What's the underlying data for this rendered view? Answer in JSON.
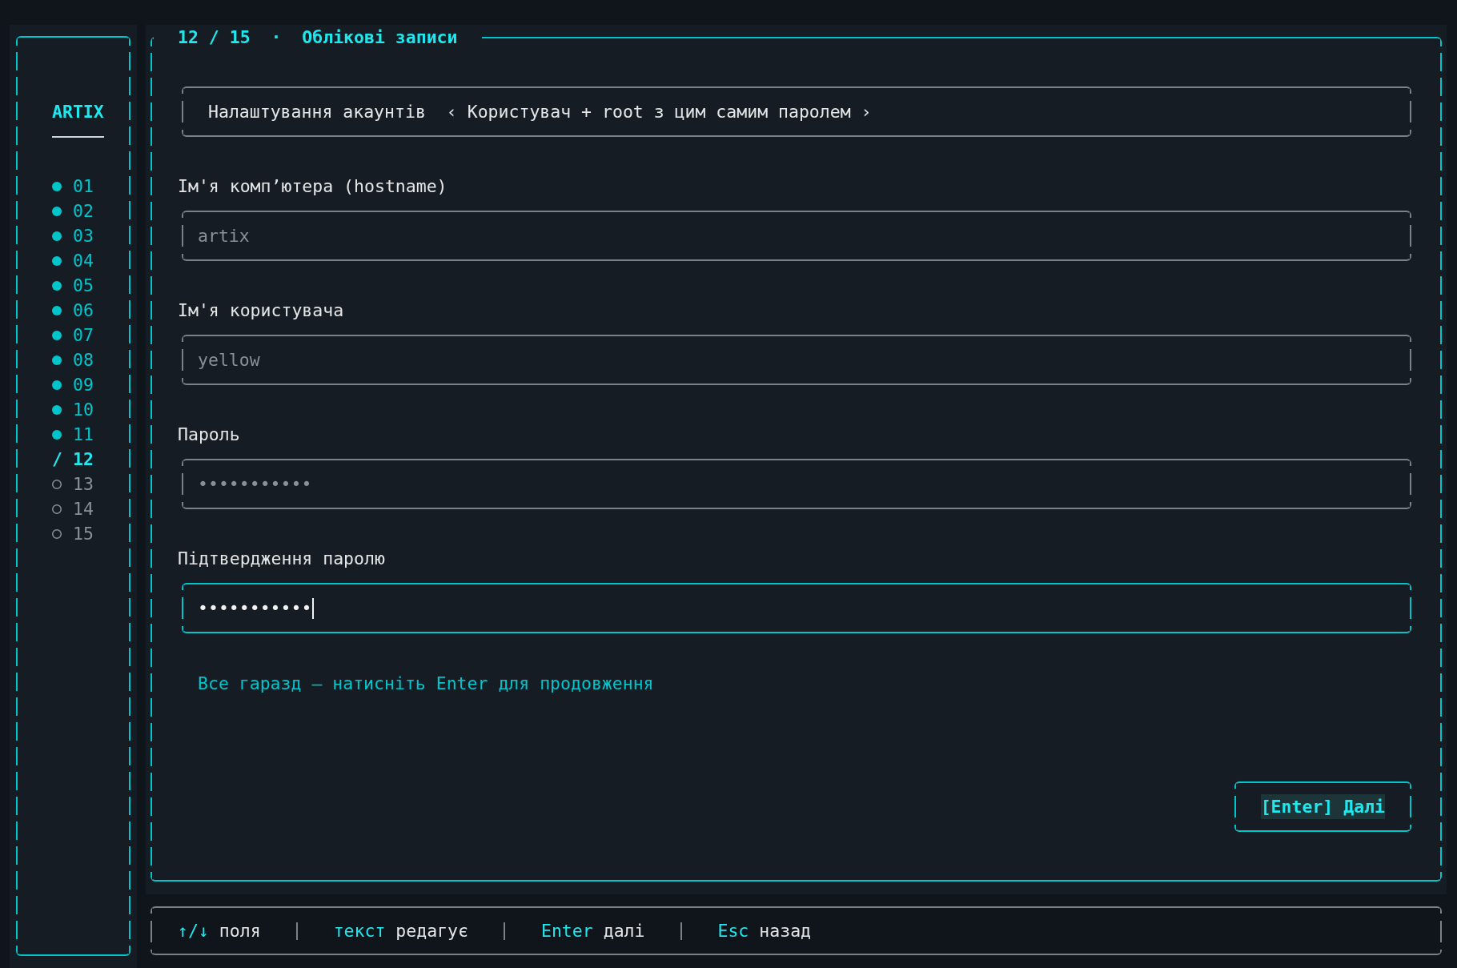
{
  "sidebar": {
    "brand": "ARTIX",
    "steps": [
      {
        "number": "01",
        "kind": "done"
      },
      {
        "number": "02",
        "kind": "done"
      },
      {
        "number": "03",
        "kind": "done"
      },
      {
        "number": "04",
        "kind": "done"
      },
      {
        "number": "05",
        "kind": "done"
      },
      {
        "number": "06",
        "kind": "done"
      },
      {
        "number": "07",
        "kind": "done"
      },
      {
        "number": "08",
        "kind": "done"
      },
      {
        "number": "09",
        "kind": "done"
      },
      {
        "number": "10",
        "kind": "done"
      },
      {
        "number": "11",
        "kind": "done"
      },
      {
        "number": "12",
        "kind": "current",
        "marker": "/"
      },
      {
        "number": "13",
        "kind": "pending"
      },
      {
        "number": "14",
        "kind": "pending"
      },
      {
        "number": "15",
        "kind": "pending"
      }
    ]
  },
  "panel": {
    "title": "12 / 15  ·  Облікові записи",
    "section": "Налаштування акаунтів",
    "mode": "‹ Користувач + root з цим самим паролем ›",
    "fields": [
      {
        "label": "Ім'я комп’ютера (hostname)",
        "value": "artix",
        "focused": false
      },
      {
        "label": "Ім'я користувача",
        "value": "yellow",
        "focused": false
      },
      {
        "label": "Пароль",
        "value": "•••••••••••",
        "focused": false
      },
      {
        "label": "Підтвердження паролю",
        "value": "•••••••••••",
        "focused": true
      }
    ],
    "message": "Все гаразд — натисніть Enter для продовження",
    "button": "[Enter] Далі"
  },
  "footer": {
    "hints": [
      {
        "key": "↑/↓",
        "label": "поля"
      },
      {
        "key": "текст",
        "label": "редагує"
      },
      {
        "key": "Enter",
        "label": "далі"
      },
      {
        "key": "Esc",
        "label": "назад"
      }
    ]
  }
}
